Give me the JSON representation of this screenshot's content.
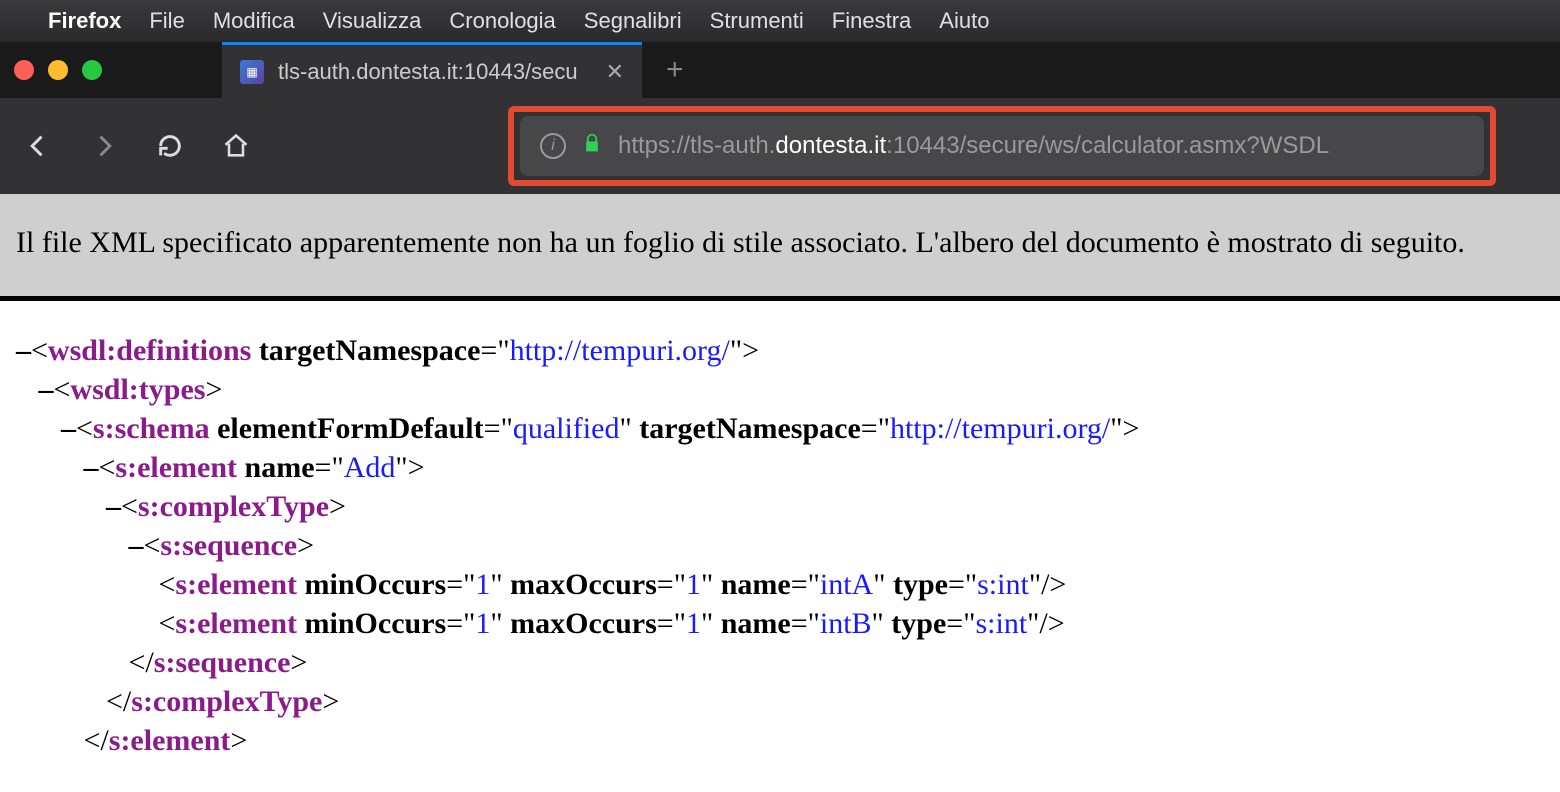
{
  "menubar": {
    "app": "Firefox",
    "items": [
      "File",
      "Modifica",
      "Visualizza",
      "Cronologia",
      "Segnalibri",
      "Strumenti",
      "Finestra",
      "Aiuto"
    ]
  },
  "tab": {
    "title": "tls-auth.dontesta.it:10443/secu"
  },
  "url": {
    "scheme": "https://",
    "sub": "tls-auth.",
    "domain": "dontesta.it",
    "port_path": ":10443/secure/ws/calculator.asmx?WSDL"
  },
  "banner": {
    "text": "Il file XML specificato apparentemente non ha un foglio di stile associato. L'albero del documento è mostrato di seguito."
  },
  "xml": {
    "toggle": "–",
    "lt": "<",
    "gt": ">",
    "close_lt": "</",
    "self_close": "/>",
    "eq": "=",
    "q": "\"",
    "nodes": {
      "definitions": {
        "tag": "wsdl:definitions",
        "attrs": [
          {
            "n": "targetNamespace",
            "v": "http://tempuri.org/"
          }
        ]
      },
      "types": {
        "tag": "wsdl:types"
      },
      "schema": {
        "tag": "s:schema",
        "attrs": [
          {
            "n": "elementFormDefault",
            "v": "qualified"
          },
          {
            "n": "targetNamespace",
            "v": "http://tempuri.org/"
          }
        ]
      },
      "element_add": {
        "tag": "s:element",
        "attrs": [
          {
            "n": "name",
            "v": "Add"
          }
        ]
      },
      "complexType": {
        "tag": "s:complexType"
      },
      "sequence": {
        "tag": "s:sequence"
      },
      "el_intA": {
        "tag": "s:element",
        "attrs": [
          {
            "n": "minOccurs",
            "v": "1"
          },
          {
            "n": "maxOccurs",
            "v": "1"
          },
          {
            "n": "name",
            "v": "intA"
          },
          {
            "n": "type",
            "v": "s:int"
          }
        ]
      },
      "el_intB": {
        "tag": "s:element",
        "attrs": [
          {
            "n": "minOccurs",
            "v": "1"
          },
          {
            "n": "maxOccurs",
            "v": "1"
          },
          {
            "n": "name",
            "v": "intB"
          },
          {
            "n": "type",
            "v": "s:int"
          }
        ]
      },
      "sequence_close": {
        "tag": "s:sequence"
      },
      "complexType_close": {
        "tag": "s:complexType"
      },
      "element_close": {
        "tag": "s:element"
      }
    }
  }
}
